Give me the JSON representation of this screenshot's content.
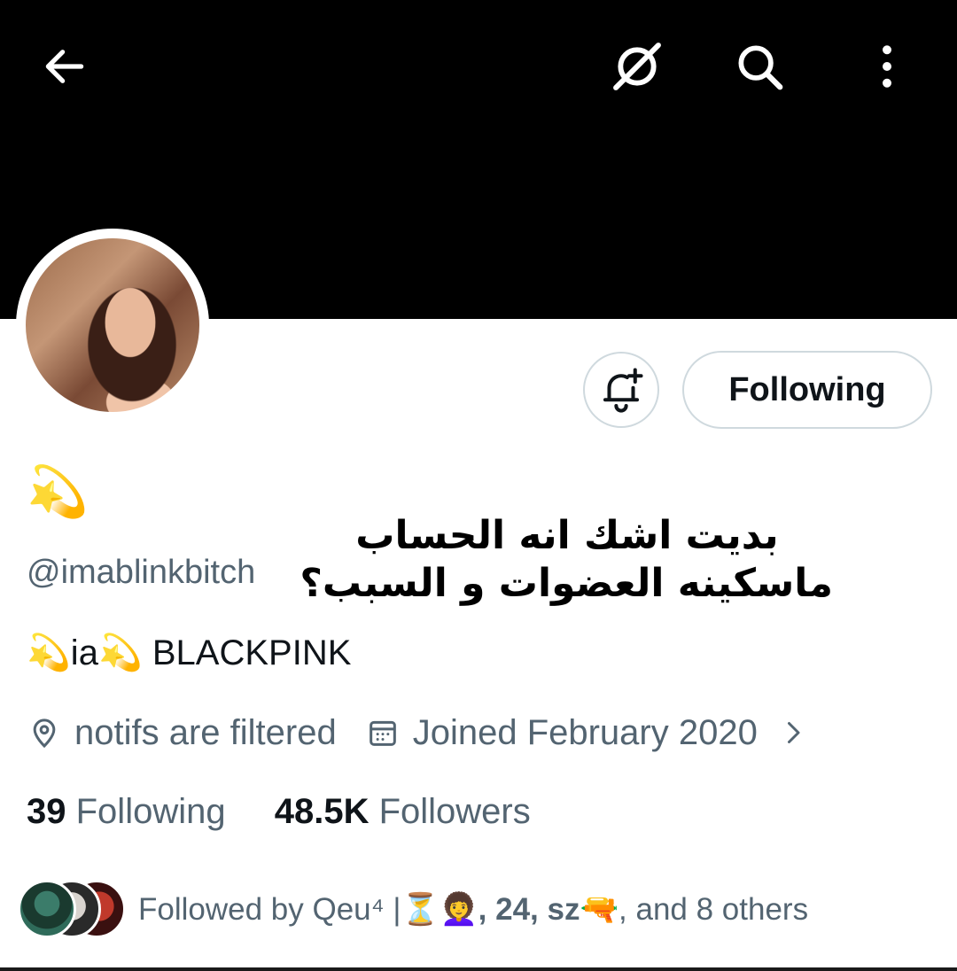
{
  "header": {
    "back_icon": "arrow-left-icon",
    "action_icons": [
      "grok-icon",
      "search-icon",
      "more-vertical-icon"
    ]
  },
  "profile": {
    "display_name": "💫",
    "handle": "@imablinkbitch",
    "bio": "💫ia💫  BLACKPINK",
    "location": "notifs are filtered",
    "joined": "Joined February 2020",
    "following_count": "39",
    "following_label": "Following",
    "followers_count": "48.5K",
    "followers_label": "Followers"
  },
  "actions": {
    "notify_icon": "bell-plus-icon",
    "following_button": "Following"
  },
  "followed_by": {
    "prefix": "Followed by Qeu⁴ |⏳👩‍🦱",
    "names": ", 24, sz🔫",
    "suffix": ", and 8 others"
  },
  "overlay_caption": {
    "line1": "بديت اشك انه الحساب",
    "line2": "ماسكينه العضوات و السبب؟"
  },
  "colors": {
    "banner": "#000000",
    "text_primary": "#0f1419",
    "text_secondary": "#536471",
    "border": "#cfd9de"
  }
}
